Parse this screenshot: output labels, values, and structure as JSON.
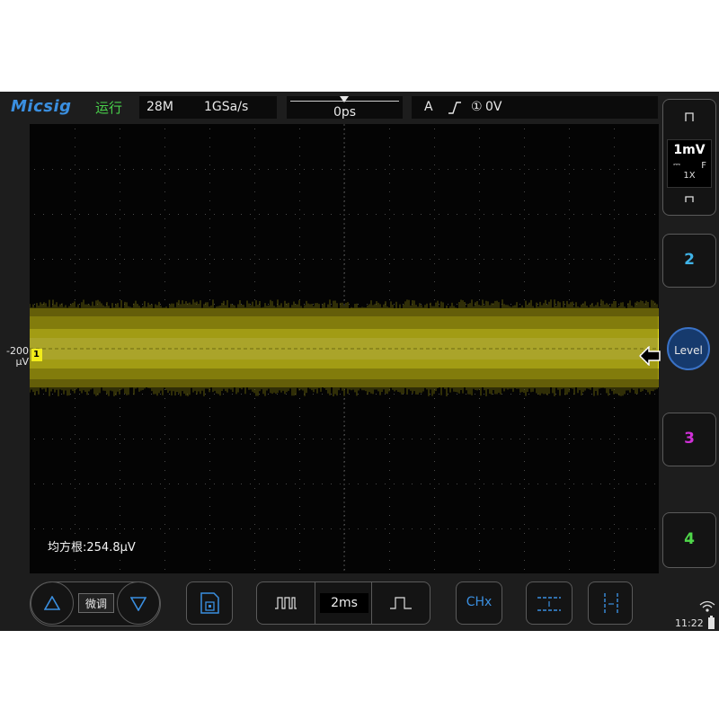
{
  "header": {
    "logo": "Micsig",
    "run_state": "运行",
    "memory_depth": "28M",
    "sample_rate": "1GSa/s",
    "horizontal_position": "0ps",
    "trigger": {
      "mode": "A",
      "edge_icon": "rising-edge-icon",
      "source": "①",
      "level": "0V"
    }
  },
  "screen": {
    "measurement": "均方根:254.8μV",
    "trace_color": "#f1ec1a"
  },
  "channel1": {
    "label": "1",
    "offset_line1": "-200",
    "offset_line2": "μV",
    "volts_per_div": "1mV",
    "coupling_icon": "dc-coupling-icon",
    "bandwidth": "F",
    "probe": "1X"
  },
  "right_panel": {
    "channels": [
      {
        "label": "2",
        "color": "#3fb2e6"
      },
      {
        "label": "3",
        "color": "#d030d8"
      },
      {
        "label": "4",
        "color": "#4fd84a"
      }
    ],
    "level_button": "Level"
  },
  "bottom": {
    "fine_label": "微调",
    "timebase": "2ms",
    "chx_label": "CHx"
  },
  "status": {
    "time": "11:22",
    "wifi_icon": "wifi-icon",
    "battery_icon": "battery-icon"
  }
}
